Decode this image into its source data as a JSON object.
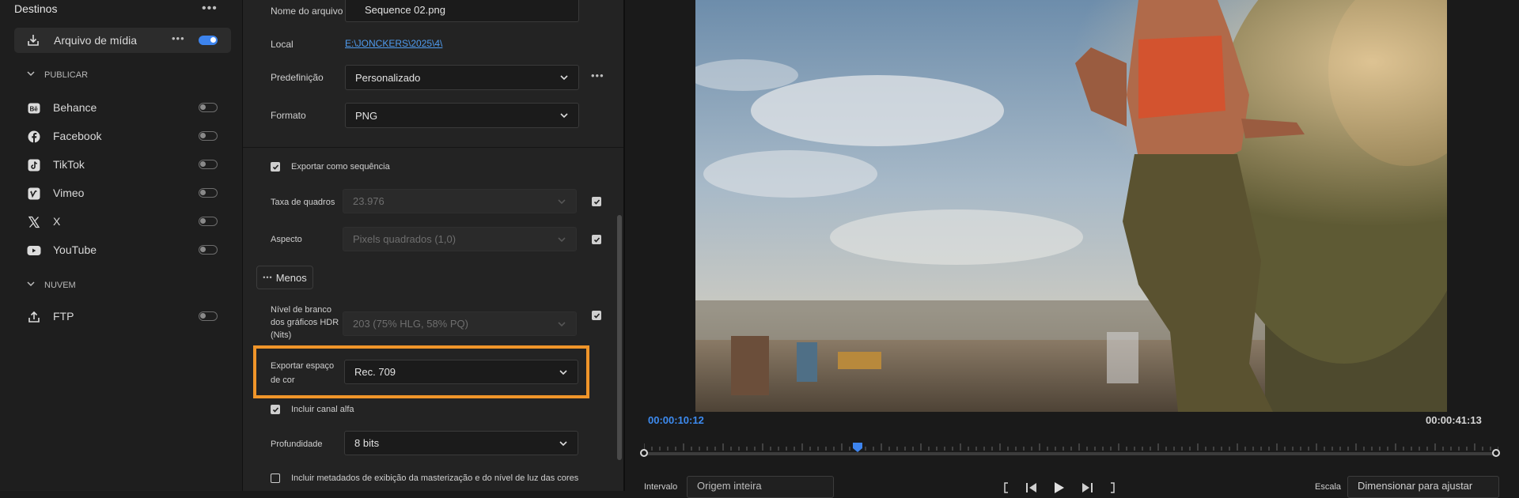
{
  "destinations": {
    "title": "Destinos",
    "selected": {
      "label": "Arquivo de mídia",
      "icon": "download-icon",
      "enabled": true
    },
    "publish_header": "PUBLICAR",
    "publish_items": [
      {
        "label": "Behance",
        "icon": "behance-icon"
      },
      {
        "label": "Facebook",
        "icon": "facebook-icon"
      },
      {
        "label": "TikTok",
        "icon": "tiktok-icon"
      },
      {
        "label": "Vimeo",
        "icon": "vimeo-icon"
      },
      {
        "label": "X",
        "icon": "x-icon"
      },
      {
        "label": "YouTube",
        "icon": "youtube-icon"
      }
    ],
    "cloud_header": "NUVEM",
    "cloud_items": [
      {
        "label": "FTP",
        "icon": "upload-icon"
      }
    ]
  },
  "settings": {
    "filename_label": "Nome do arquivo",
    "filename_value": "Sequence 02.png",
    "location_label": "Local",
    "location_value": "E:\\JONCKERS\\2025\\4\\",
    "preset_label": "Predefinição",
    "preset_value": "Personalizado",
    "format_label": "Formato",
    "format_value": "PNG",
    "export_sequence_label": "Exportar como sequência",
    "framerate_label": "Taxa de quadros",
    "framerate_value": "23.976",
    "aspect_label": "Aspecto",
    "aspect_value": "Pixels quadrados (1,0)",
    "less_button": "Menos",
    "hdr_label": "Nível de branco dos gráficos HDR (Nits)",
    "hdr_value": "203 (75% HLG, 58% PQ)",
    "colorspace_label": "Exportar espaço de cor",
    "colorspace_value": "Rec. 709",
    "alpha_label": "Incluir canal alfa",
    "depth_label": "Profundidade",
    "depth_value": "8 bits",
    "metadata_label": "Incluir metadados de exibição da masterização e do nível de luz das cores"
  },
  "preview": {
    "current_time": "00:00:10:12",
    "duration": "00:00:41:13",
    "playhead_fraction": 0.25,
    "range_label": "Intervalo",
    "range_value": "Origem inteira",
    "scale_label": "Escala",
    "scale_value": "Dimensionar para ajustar"
  },
  "colors": {
    "accent": "#3d84ee",
    "highlight": "#f0952a",
    "link": "#4f9cf0"
  }
}
